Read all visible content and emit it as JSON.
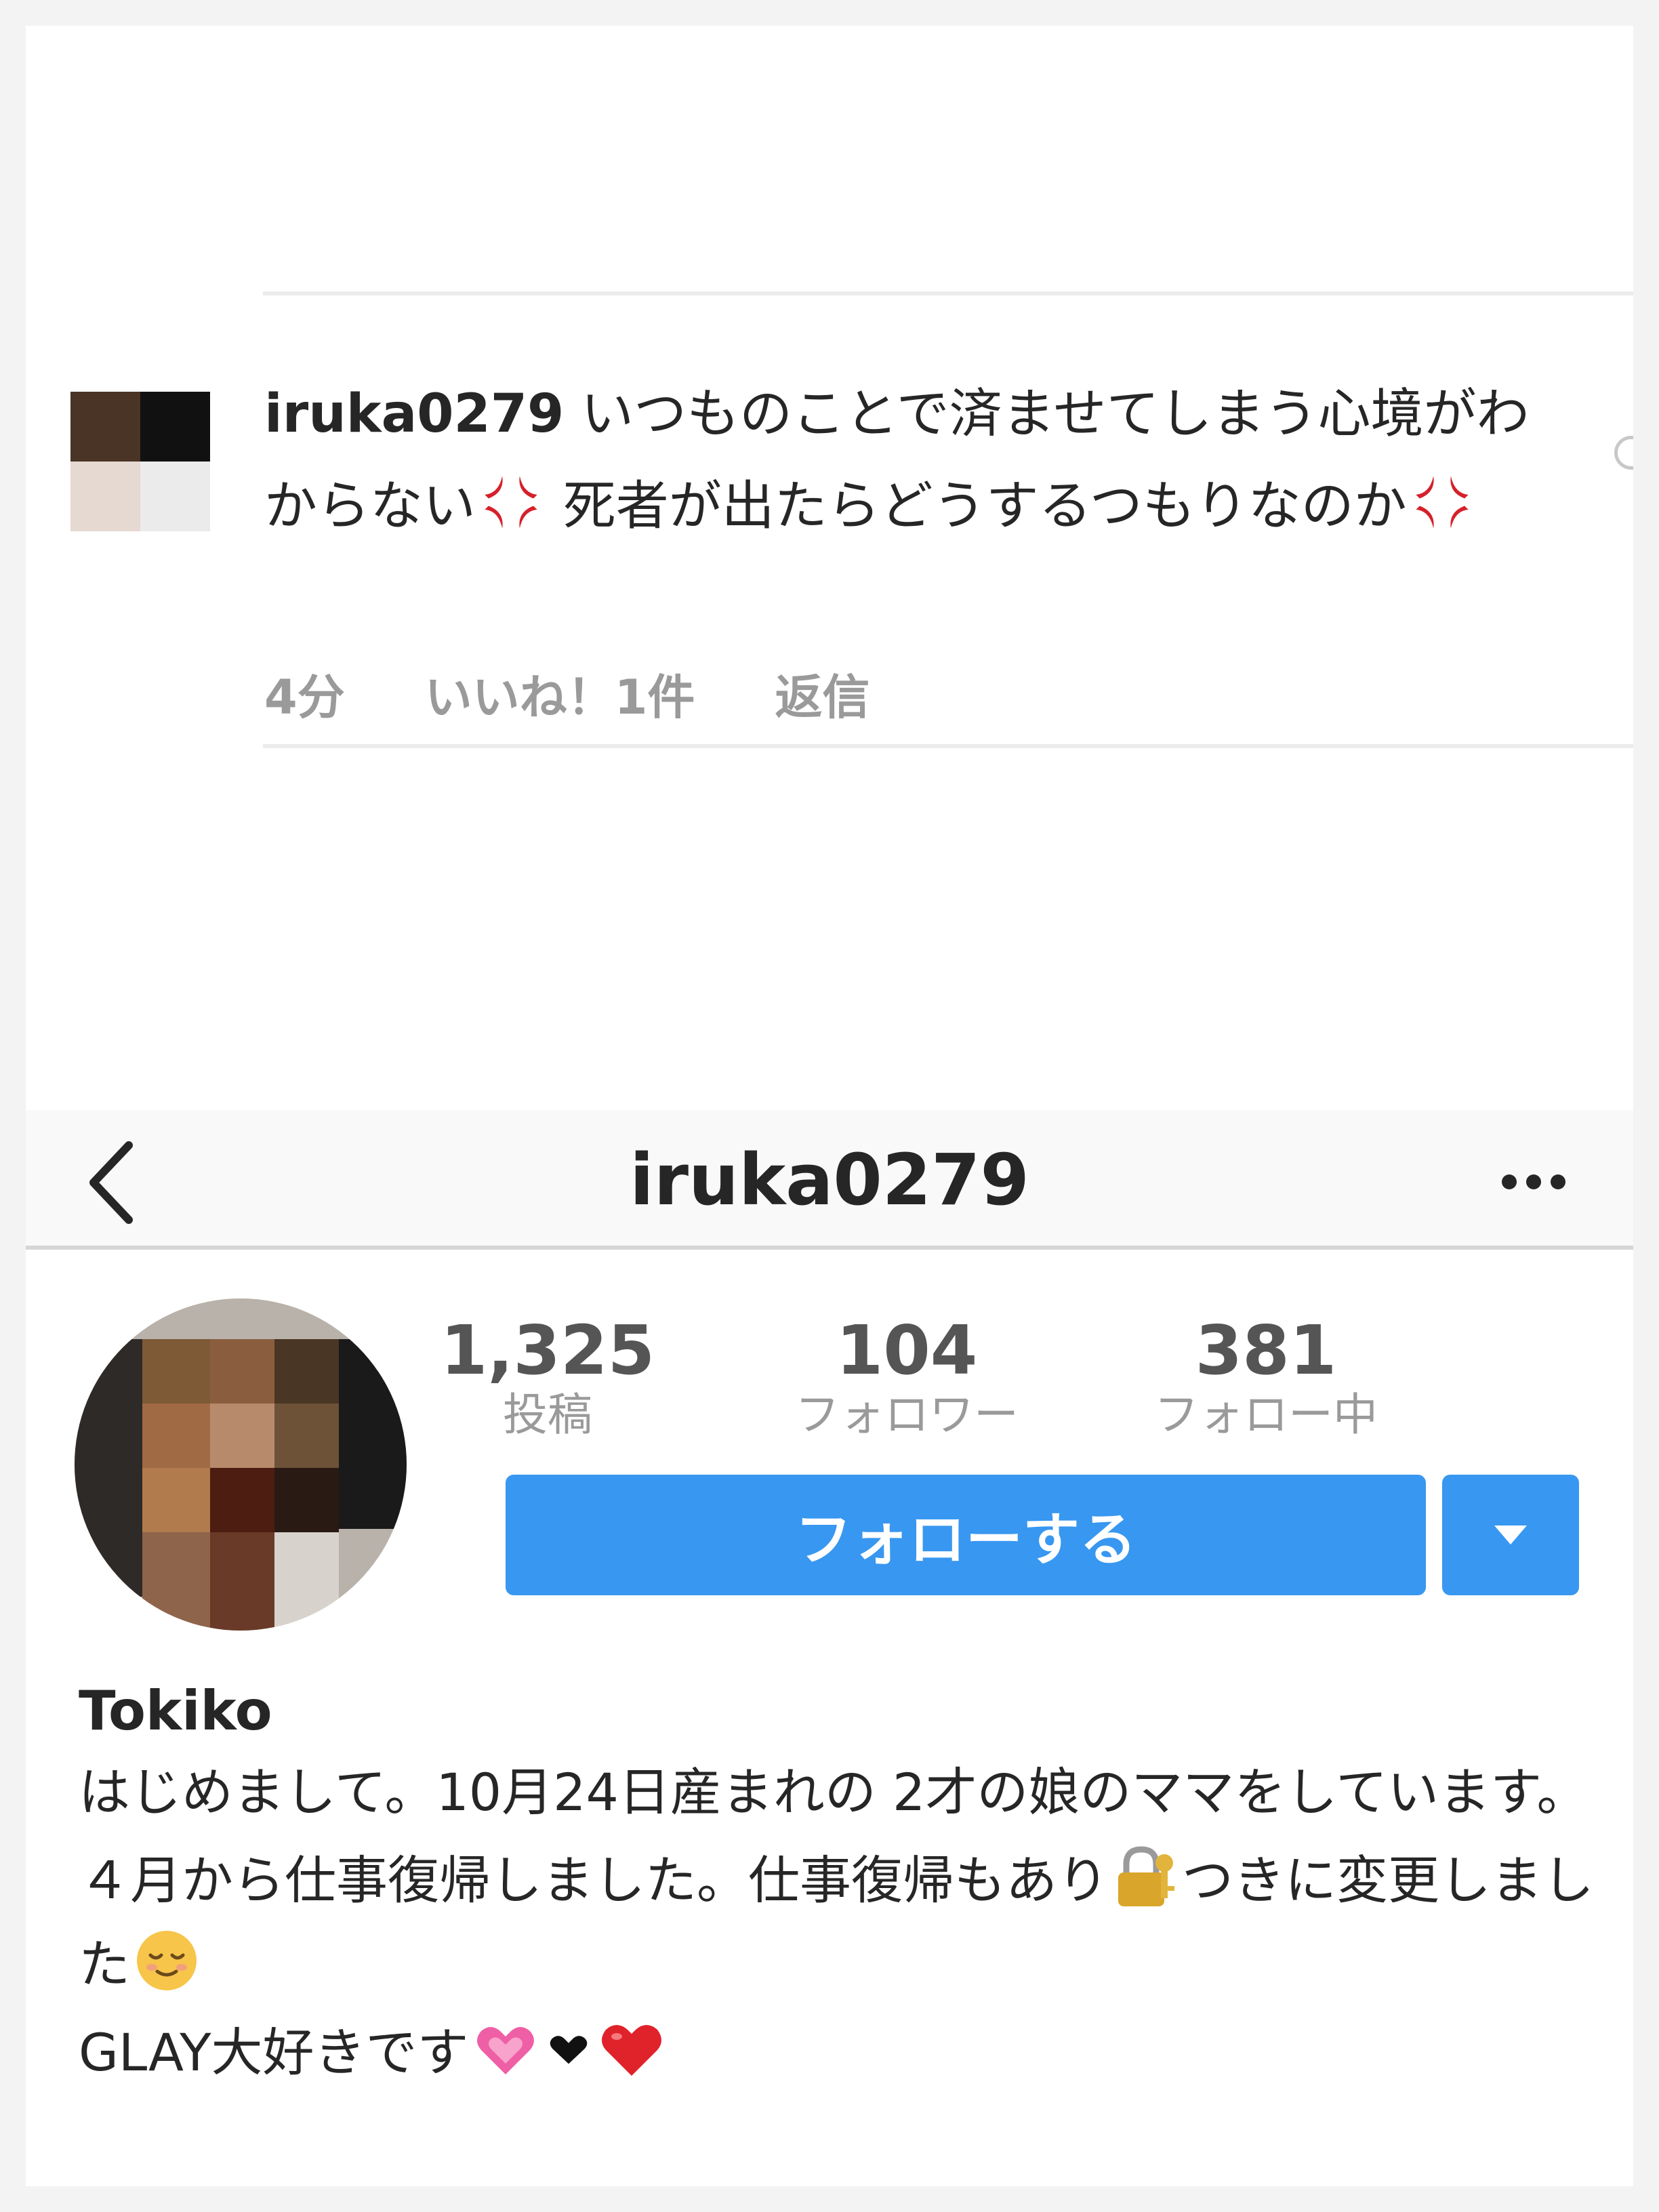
{
  "comment": {
    "username": "iruka0279",
    "text_part1": " いつものことで済ませてしまう心境がわからない",
    "text_part2": " 死者が出たらどうするつもりなのか",
    "time": "4分",
    "likes": "いいね！1件",
    "reply": "返信",
    "avatar_colors": [
      "#4a3426",
      "#111111",
      "#e6d9d2",
      "#ebebeb"
    ]
  },
  "navbar": {
    "title": "iruka0279",
    "back_icon": "chevron-left-icon",
    "more_icon": "ellipsis-icon"
  },
  "profile": {
    "stats": [
      {
        "value": "1,325",
        "label": "投稿"
      },
      {
        "value": "104",
        "label": "フォロワー"
      },
      {
        "value": "381",
        "label": "フォロー中"
      }
    ],
    "follow_label": "フォローする",
    "accent": "#3897f0",
    "name": "Tokiko",
    "bio_line1": "はじめまして。10月24日産まれの 2才の娘のママをしています。",
    "bio_line2a": "４月から仕事復帰しました。仕事復帰もあり",
    "bio_line2b": "つきに変更しました",
    "bio_line3": "GLAY大好きです"
  }
}
